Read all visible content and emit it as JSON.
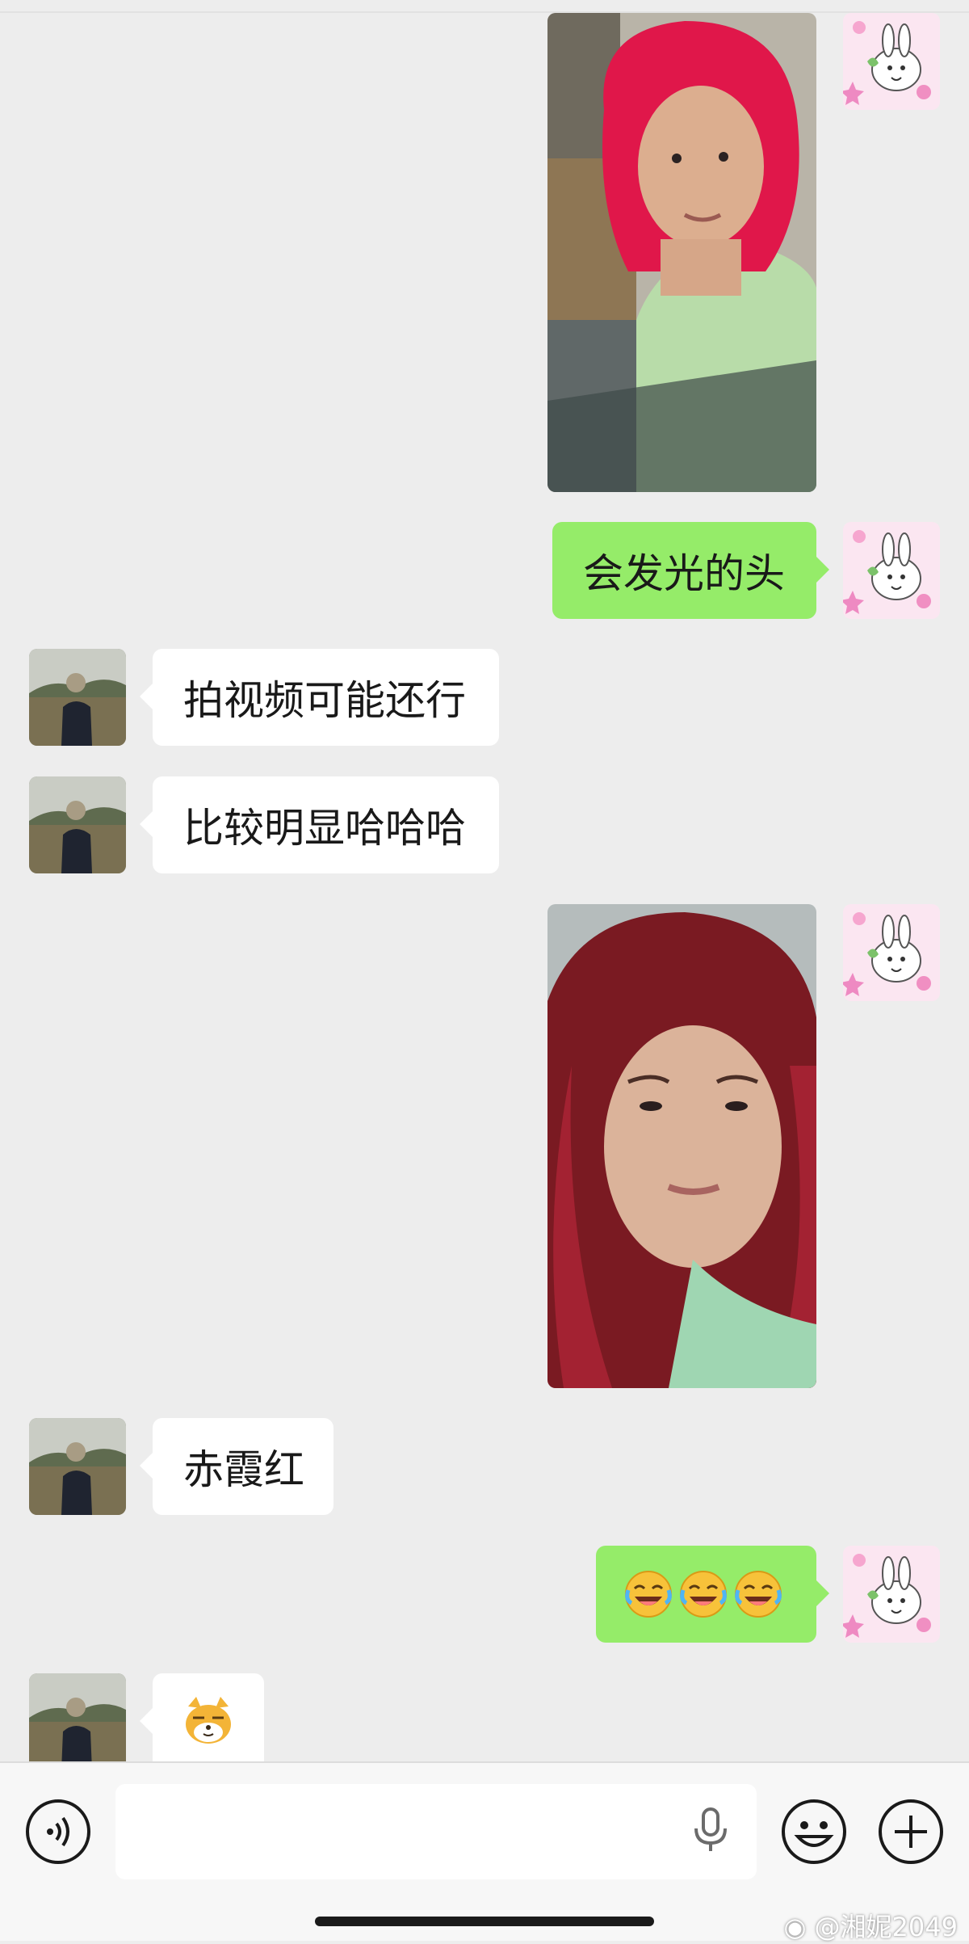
{
  "messages": [
    {
      "sender": "me",
      "type": "image",
      "description": "selfie"
    },
    {
      "sender": "me",
      "type": "text",
      "text": "会发光的头"
    },
    {
      "sender": "contact",
      "type": "text",
      "text": "拍视频可能还行"
    },
    {
      "sender": "contact",
      "type": "text",
      "text": "比较明显哈哈哈"
    },
    {
      "sender": "me",
      "type": "image",
      "description": "selfie"
    },
    {
      "sender": "contact",
      "type": "text",
      "text": "赤霞红"
    },
    {
      "sender": "me",
      "type": "emoji",
      "emoji_name": "rolling-on-the-floor-laughing",
      "count": 3
    },
    {
      "sender": "contact",
      "type": "sticker",
      "emoji_name": "doge-cat"
    }
  ],
  "input": {
    "placeholder": "",
    "value": "",
    "icons": [
      "voice-icon",
      "microphone-icon",
      "emoji-icon",
      "add-icon"
    ]
  },
  "watermark": "@湘妮2049",
  "colors": {
    "background": "#ededed",
    "outgoing_bubble": "#95ec69",
    "incoming_bubble": "#ffffff"
  }
}
